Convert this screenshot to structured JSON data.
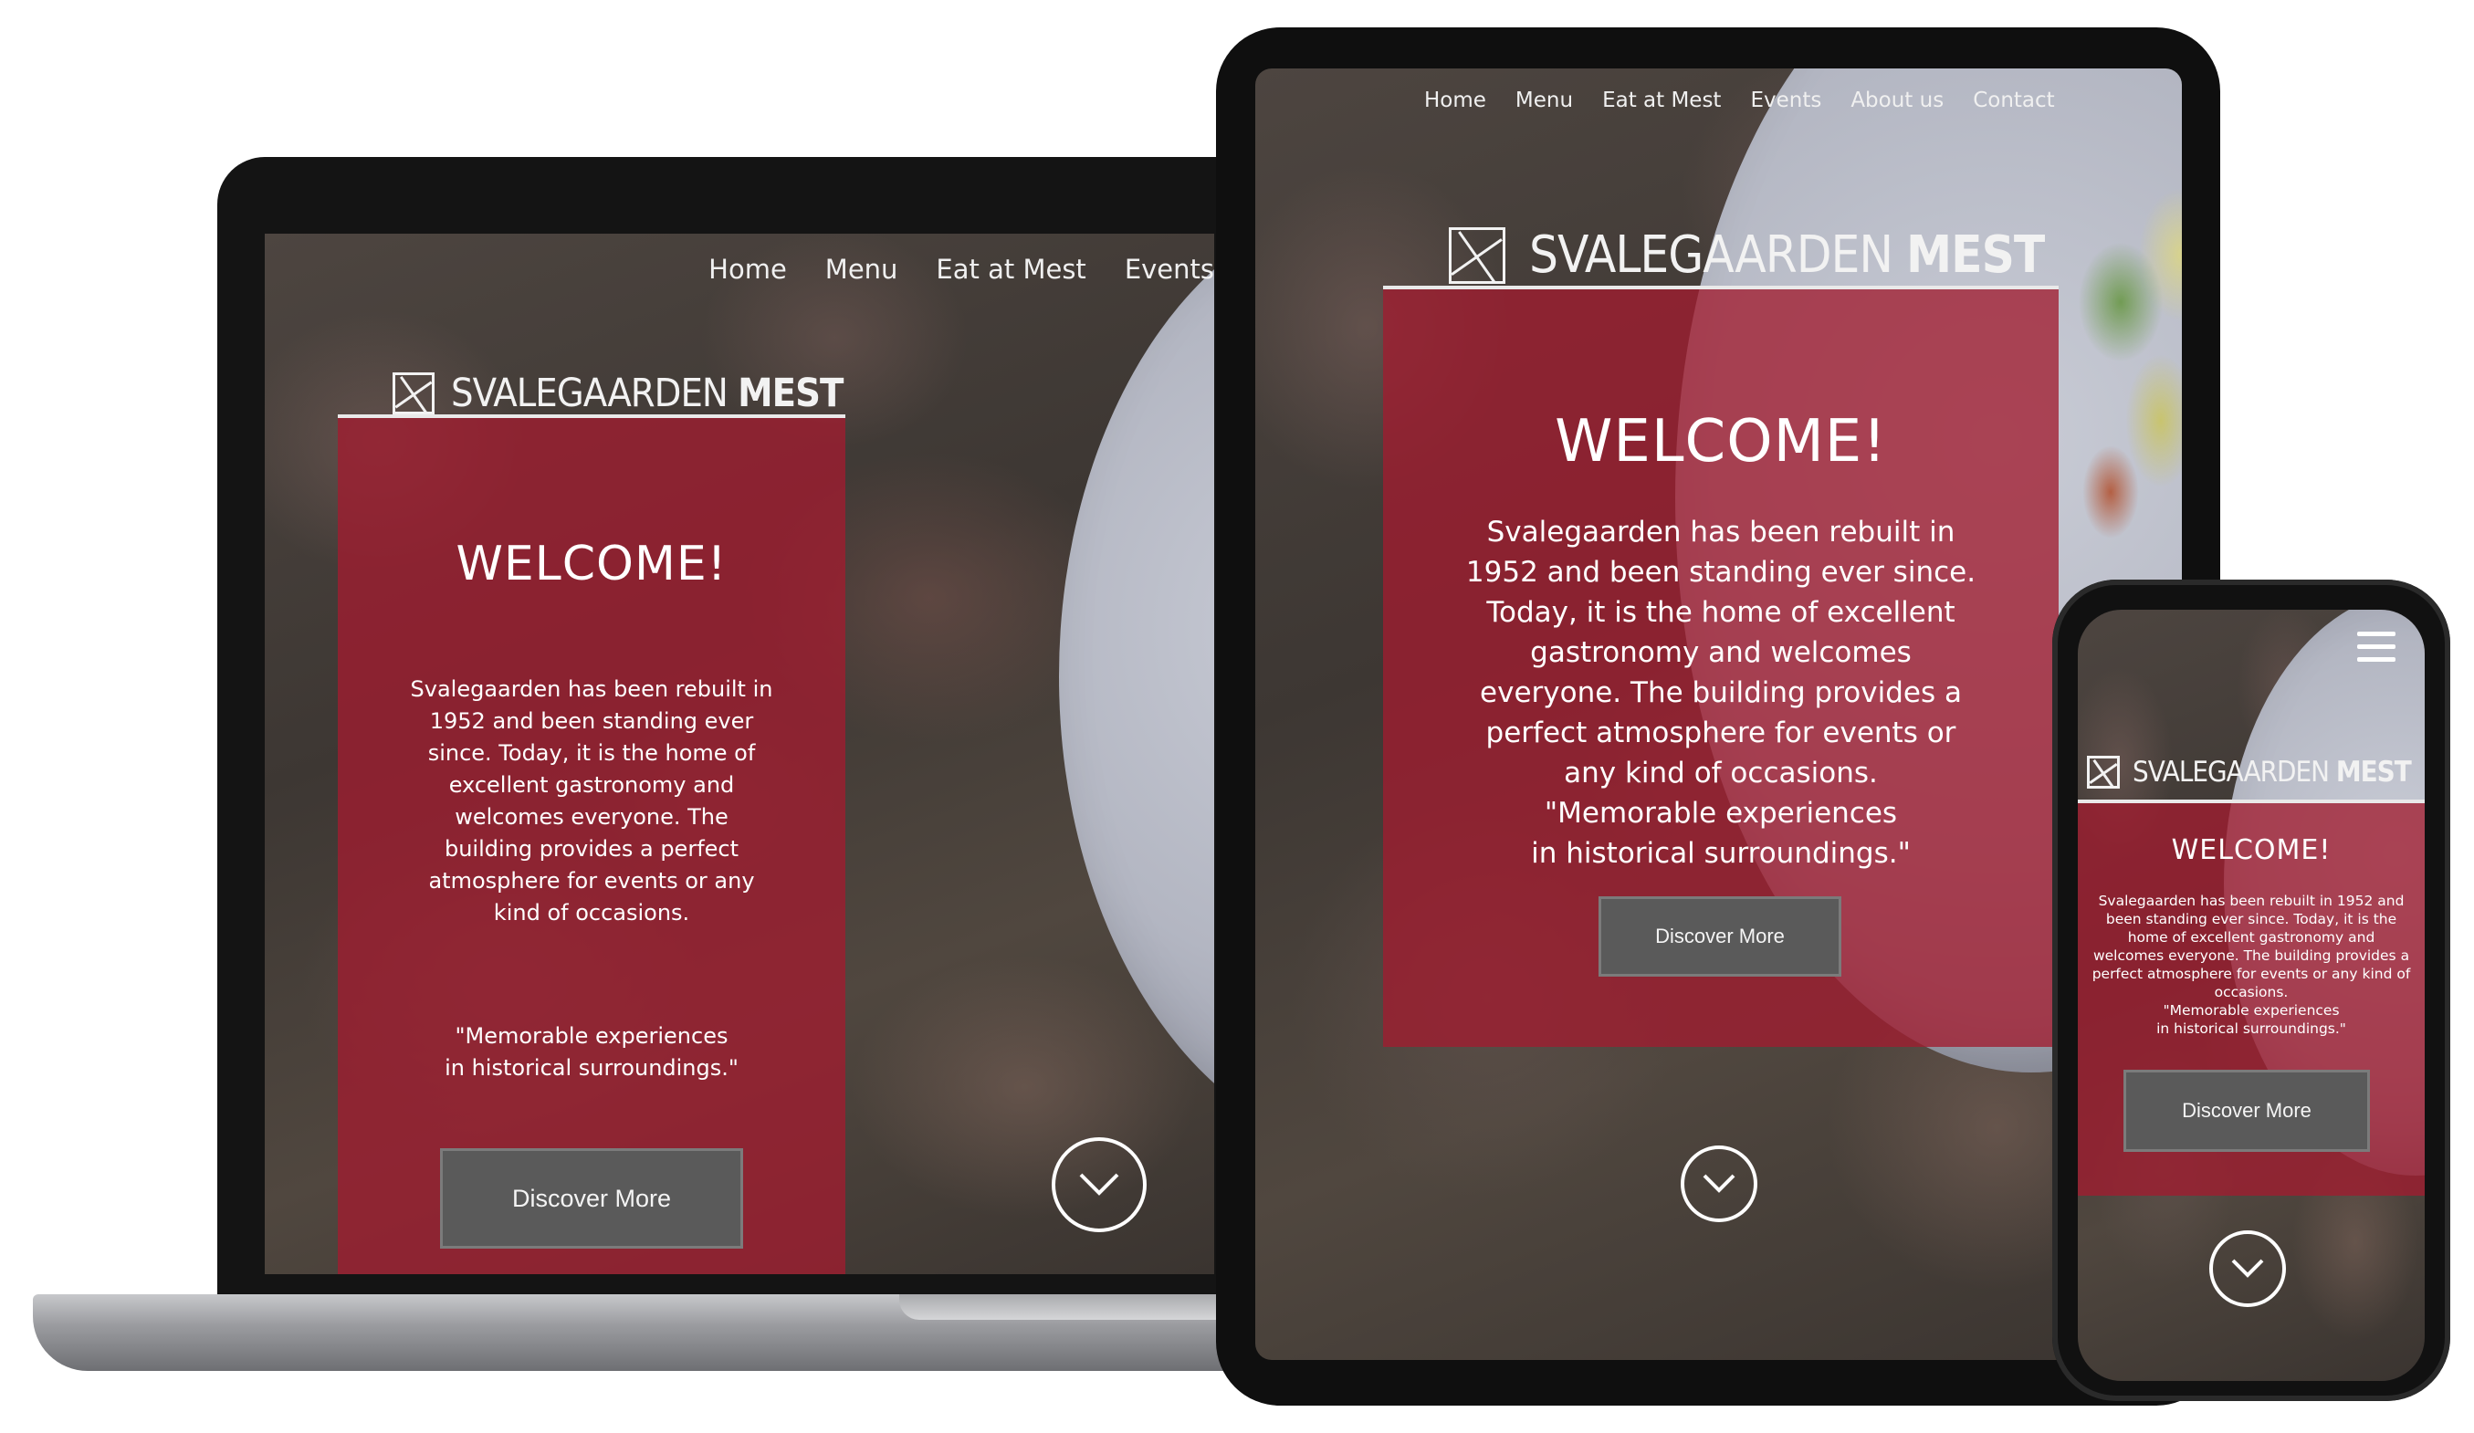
{
  "site": {
    "logo": {
      "name_light": "SVALEGAARDEN",
      "name_bold": "MEST"
    },
    "nav_items": [
      "Home",
      "Menu",
      "Eat at Mest",
      "Events",
      "About us",
      "Contact"
    ],
    "welcome": {
      "title": "WELCOME!",
      "body": "Svalegaarden has been rebuilt in 1952 and been standing ever since. Today, it is the home of excellent gastronomy and welcomes everyone. The building provides a perfect atmosphere for events or any kind of occasions.",
      "quote_line1": "\"Memorable experiences",
      "quote_line2": "in historical surroundings.\"",
      "button": "Discover More"
    }
  },
  "colors": {
    "panel_red": "#a01c30",
    "button_gray": "#5a5a5a",
    "frame_black": "#141414",
    "laptop_silver": "#9b9ca0"
  },
  "icons": {
    "scroll_down": "chevron-down-circle-icon",
    "menu": "hamburger-menu-icon",
    "logo_mark": "square-logo-mark-icon"
  }
}
